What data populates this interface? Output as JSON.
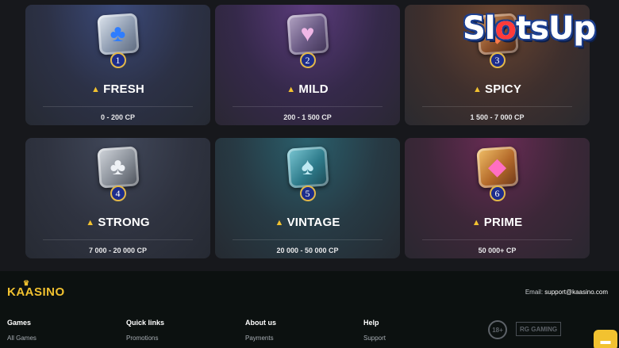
{
  "tiers": [
    {
      "level": "1",
      "name": "FRESH",
      "range": "0 - 200 CP",
      "icon": "blue-clover-tile-icon"
    },
    {
      "level": "2",
      "name": "MILD",
      "range": "200 - 1 500 CP",
      "icon": "pink-heart-tile-icon"
    },
    {
      "level": "3",
      "name": "SPICY",
      "range": "1 500 - 7 000 CP",
      "icon": "orange-gem-tile-icon"
    },
    {
      "level": "4",
      "name": "STRONG",
      "range": "7 000 - 20 000 CP",
      "icon": "silver-club-tile-icon"
    },
    {
      "level": "5",
      "name": "VINTAGE",
      "range": "20 000 - 50 000 CP",
      "icon": "teal-spade-tile-icon"
    },
    {
      "level": "6",
      "name": "PRIME",
      "range": "50 000+ CP",
      "icon": "pink-diamond-tile-icon"
    }
  ],
  "tier_glyphs": [
    "♣",
    "♥",
    "◆",
    "♣",
    "♠",
    "◆"
  ],
  "cheese_icon": "cheese-icon",
  "watermark": {
    "part1": "Sl",
    "dot": "o",
    "part2": "tsUp"
  },
  "footer": {
    "logo": "KAASINO",
    "email_label": "Email:",
    "email": "support@kaasino.com",
    "columns": [
      {
        "heading": "Games",
        "link": "All Games"
      },
      {
        "heading": "Quick links",
        "link": "Promotions"
      },
      {
        "heading": "About us",
        "link": "Payments"
      },
      {
        "heading": "Help",
        "link": "Support"
      }
    ],
    "age_badge": "18+",
    "rg_badge": "RG GAMING"
  },
  "colors": {
    "accent": "#f2c230",
    "badge_blue": "#1d2d8c",
    "footer_bg": "#0c1110"
  }
}
